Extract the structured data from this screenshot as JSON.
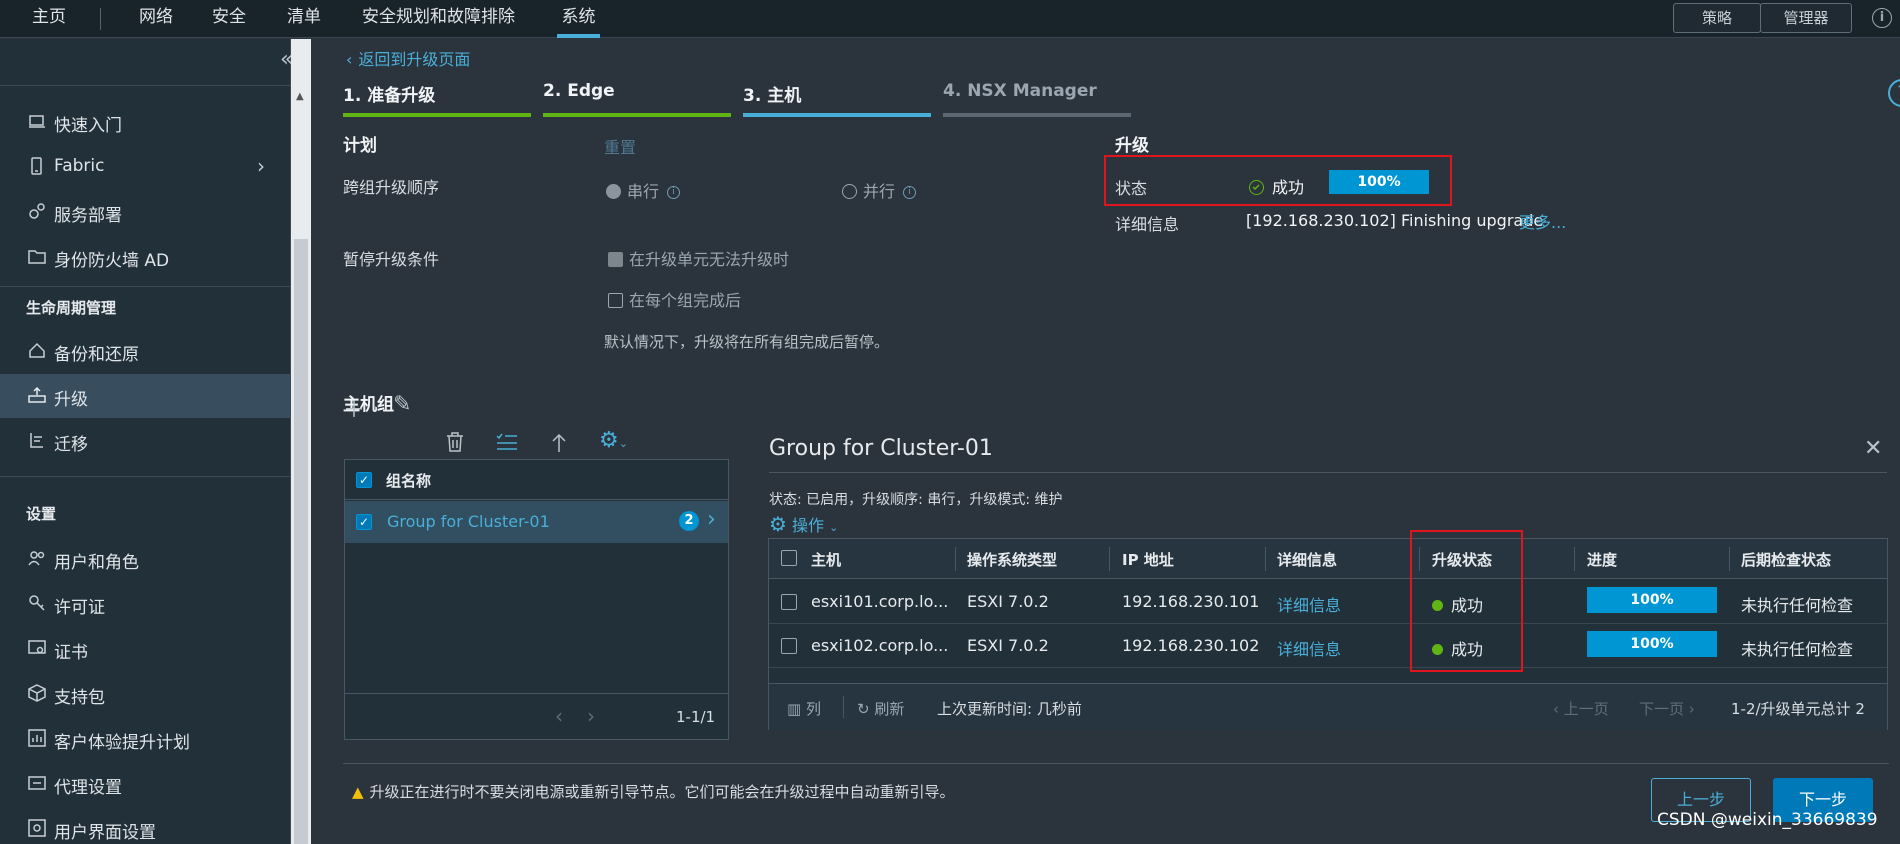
{
  "topnav": {
    "home": "主页",
    "tabs": [
      "网络",
      "安全",
      "清单",
      "安全规划和故障排除",
      "系统"
    ],
    "active_tab": "系统",
    "policy_button": "策略",
    "admin_button": "管理器",
    "info_icon": "info-icon"
  },
  "sidebar": {
    "items_top": [
      {
        "label": "快速入门",
        "icon": "rocket-icon"
      },
      {
        "label": "Fabric",
        "icon": "fabric-icon"
      },
      {
        "label": "服务部署",
        "icon": "service-icon"
      },
      {
        "label": "身份防火墙 AD",
        "icon": "folder-icon"
      }
    ],
    "section_lifecycle": "生命周期管理",
    "items_lifecycle": [
      {
        "label": "备份和还原",
        "icon": "backup-icon"
      },
      {
        "label": "升级",
        "icon": "upgrade-icon"
      },
      {
        "label": "迁移",
        "icon": "migrate-icon"
      }
    ],
    "section_settings": "设置",
    "items_settings": [
      {
        "label": "用户和角色",
        "icon": "users-icon"
      },
      {
        "label": "许可证",
        "icon": "key-icon"
      },
      {
        "label": "证书",
        "icon": "certificate-icon"
      },
      {
        "label": "支持包",
        "icon": "package-icon"
      },
      {
        "label": "客户体验提升计划",
        "icon": "chart-icon"
      },
      {
        "label": "代理设置",
        "icon": "proxy-icon"
      },
      {
        "label": "用户界面设置",
        "icon": "ui-settings-icon"
      }
    ],
    "active_item": "升级"
  },
  "main": {
    "back_link": "返回到升级页面",
    "steps": [
      {
        "label": "1. 准备升级",
        "color": "#60b515"
      },
      {
        "label": "2. Edge",
        "color": "#60b515"
      },
      {
        "label": "3. 主机",
        "color": "#49afd9"
      },
      {
        "label": "4. NSX Manager",
        "color": "#5b6873"
      }
    ],
    "plan": {
      "title": "计划",
      "reset": "重置",
      "order_label": "跨组升级顺序",
      "serial": "串行",
      "parallel": "并行",
      "pause_label": "暂停升级条件",
      "pause_opt1": "在升级单元无法升级时",
      "pause_opt2": "在每个组完成后",
      "default_note": "默认情况下，升级将在所有组完成后暂停。"
    },
    "upgrade": {
      "title": "升级",
      "status_label": "状态",
      "status_value": "成功",
      "progress_text": "100%",
      "progress": 1.0,
      "detail_label": "详细信息",
      "detail_value": "[192.168.230.102] Finishing upgrade",
      "more_link": "更多..."
    },
    "host_groups": {
      "title": "主机组",
      "toolbar_icons": [
        "add-icon",
        "edit-icon",
        "delete-icon",
        "reorder-icon",
        "move-up-icon",
        "settings-icon"
      ],
      "column_header": "组名称",
      "rows": [
        {
          "name": "Group for Cluster-01",
          "count": "2"
        }
      ],
      "pagination": "1-1/1"
    },
    "detail": {
      "title": "Group for Cluster-01",
      "summary": "状态: 已启用，升级顺序: 串行，升级模式: 维护",
      "actions": "操作",
      "columns": [
        "主机",
        "操作系统类型",
        "IP 地址",
        "详细信息",
        "升级状态",
        "进度",
        "后期检查状态"
      ],
      "rows": [
        {
          "host": "esxi101.corp.lo...",
          "os": "ESXI 7.0.2",
          "ip": "192.168.230.101",
          "details": "详细信息",
          "status": "成功",
          "progress_text": "100%",
          "progress": 1.0,
          "post_check": "未执行任何检查"
        },
        {
          "host": "esxi102.corp.lo...",
          "os": "ESXI 7.0.2",
          "ip": "192.168.230.102",
          "details": "详细信息",
          "status": "成功",
          "progress_text": "100%",
          "progress": 1.0,
          "post_check": "未执行任何检查"
        }
      ],
      "footer": {
        "columns_btn": "列",
        "refresh_btn": "刷新",
        "last_update": "上次更新时间: 几秒前",
        "prev": "上一页",
        "next": "下一页",
        "total": "1-2/升级单元总计 2"
      }
    },
    "warning": "升级正在进行时不要关闭电源或重新引导节点。它们可能会在升级过程中自动重新引导。",
    "prev_button": "上一步",
    "next_button": "下一步"
  },
  "watermark": "CSDN @weixin_33669839",
  "colors": {
    "accent": "#49afd9",
    "success": "#60b515",
    "progress": "#0095d3",
    "highlight_border": "#e0141d"
  }
}
